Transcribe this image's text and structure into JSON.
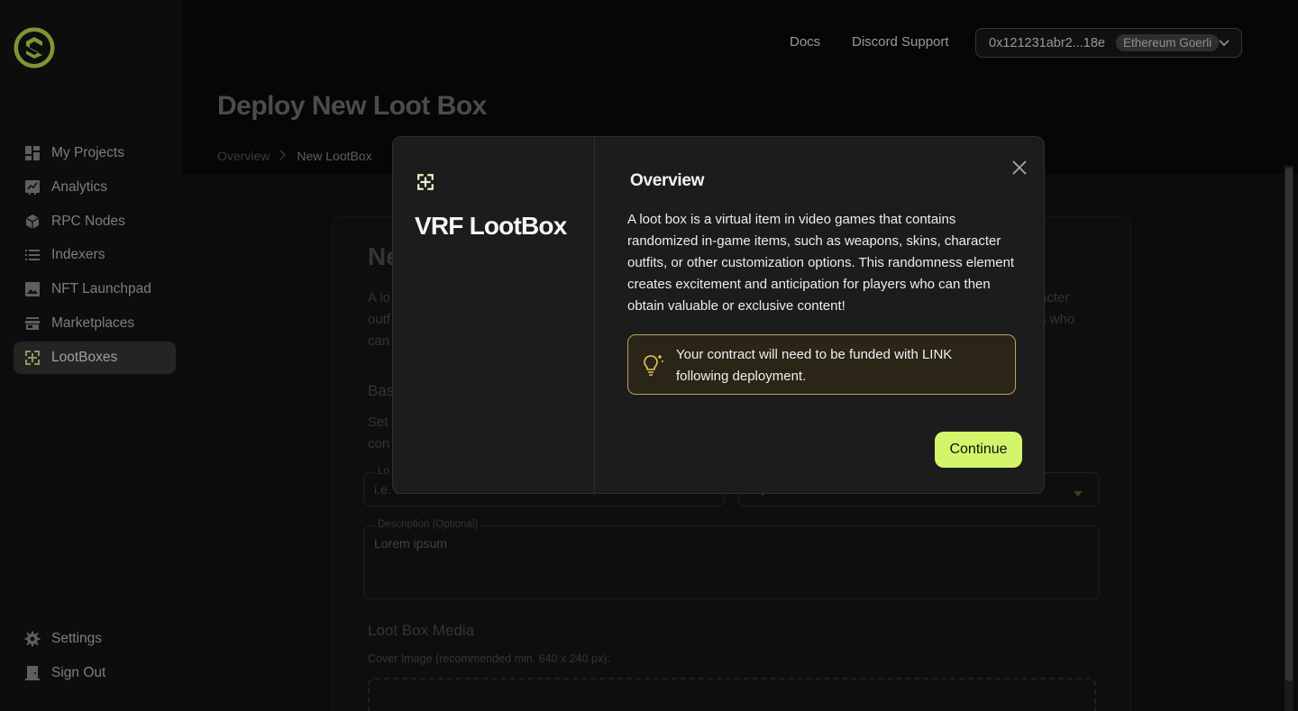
{
  "sidebar": {
    "items": [
      {
        "label": "My Projects",
        "icon": "dashboard-icon"
      },
      {
        "label": "Analytics",
        "icon": "analytics-icon"
      },
      {
        "label": "RPC Nodes",
        "icon": "cube-icon"
      },
      {
        "label": "Indexers",
        "icon": "list-icon"
      },
      {
        "label": "NFT Launchpad",
        "icon": "image-icon"
      },
      {
        "label": "Marketplaces",
        "icon": "store-icon"
      },
      {
        "label": "LootBoxes",
        "icon": "lootbox-icon",
        "active": true
      }
    ],
    "bottom_items": [
      {
        "label": "Settings",
        "icon": "gear-icon"
      },
      {
        "label": "Sign Out",
        "icon": "sign-out-icon"
      }
    ]
  },
  "header": {
    "docs_label": "Docs",
    "discord_label": "Discord Support",
    "wallet_address": "0x121231abr2...18e",
    "network": "Ethereum Goerli"
  },
  "page": {
    "title": "Deploy New Loot Box",
    "breadcrumb": [
      "Overview",
      "New LootBox"
    ]
  },
  "form_background": {
    "heading_fragment": "Ne",
    "desc_fragments_left": [
      "A lo",
      "outf",
      "can"
    ],
    "desc_fragments_right": [
      "acter",
      "s who"
    ],
    "section_fragment": "Bas",
    "section_desc_fragments": [
      "Set",
      "con"
    ],
    "name_field_label": "Lo",
    "name_placeholder_fragment": "i.e. S",
    "select_value_fragment": "y",
    "description_label": "Description (Optional)",
    "description_value": "Lorem ipsum",
    "media_heading": "Loot Box Media",
    "cover_image_label": "Cover Image (recommended min. 640 x 240 px):"
  },
  "modal": {
    "title": "VRF LootBox",
    "heading": "Overview",
    "description": "A loot box is a virtual item in video games that contains randomized in-game items, such as weapons, skins, character outfits, or other customization options. This randomness element creates excitement and anticipation for players who can then obtain valuable or exclusive content!",
    "notice": "Your contract will need to be funded with LINK following deployment.",
    "continue_label": "Continue"
  },
  "colors": {
    "accent": "#d3f56a",
    "notice_border": "#b7a15c",
    "notice_bg": "#2a2517",
    "active_nav": "#3a3a3a"
  }
}
